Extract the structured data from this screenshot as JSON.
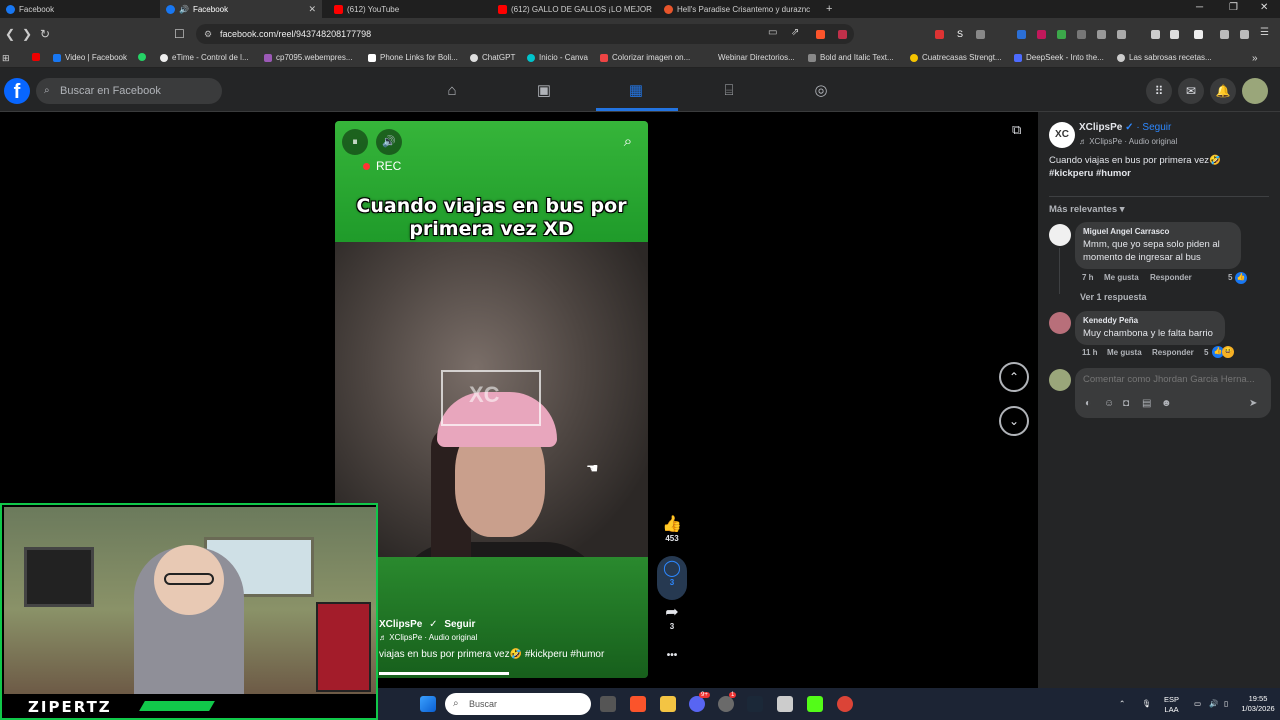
{
  "browser": {
    "tabs": [
      {
        "title": "Facebook",
        "active": false,
        "color": "#1877f2"
      },
      {
        "title": "Facebook",
        "active": true,
        "color": "#1877f2",
        "audio": true
      },
      {
        "title": "(612) YouTube",
        "active": false,
        "color": "#ff0000"
      },
      {
        "title": "(612) GALLO DE GALLOS ¡LO MEJOR",
        "active": false,
        "color": "#ff0000"
      },
      {
        "title": "Hell's Paradise Crisantemo y duraznc",
        "active": false,
        "color": "#e8552b"
      }
    ],
    "new_tab": "+",
    "url": "facebook.com/reel/943748208177798",
    "bookmarks": [
      "Video | Facebook",
      "eTime - Control de l...",
      "cp7095.webempres...",
      "Phone Links for Boli...",
      "ChatGPT",
      "Inicio - Canva",
      "Colorizar imagen on...",
      "Webinar Directorios...",
      "Bold and Italic Text...",
      "Cuatrecasas Strengt...",
      "DeepSeek - Into the...",
      "Las sabrosas recetas..."
    ],
    "extension_icon_initial": "S"
  },
  "facebook": {
    "search_placeholder": "Buscar en Facebook",
    "nav": [
      "home-icon",
      "video-icon",
      "reels-icon",
      "marketplace-icon",
      "gaming-icon"
    ],
    "active_nav": "reels-icon",
    "accent": "#2374e1"
  },
  "reel": {
    "headline": "Cuando viajas en bus por primera vez XD",
    "rec_label": "REC",
    "watermark": "XC",
    "author": "XClipsPe",
    "follow": "Seguir",
    "audio": "XClipsPe · Audio original",
    "caption": "viajas en bus por primera vez🤣 #kickperu #humor",
    "likes": "453",
    "comments": "3",
    "shares": "3",
    "more": "•••"
  },
  "panel": {
    "author": "XClipsPe",
    "verified": "✓",
    "follow": "· Seguir",
    "audio": "♬ XClipsPe · Audio original",
    "caption": "Cuando viajas en bus por primera vez🤣",
    "hashtags": "#kickperu #humor",
    "sort": "Más relevantes",
    "comments": [
      {
        "author": "Miguel Angel Carrasco",
        "text": "Mmm, que yo sepa solo piden al momento de ingresar al bus",
        "time": "7 h",
        "like": "Me gusta",
        "reply": "Responder",
        "reactions": "5"
      },
      {
        "author": "Keneddy Peña",
        "text": "Muy chambona y le falta barrio",
        "time": "11 h",
        "like": "Me gusta",
        "reply": "Responder",
        "reactions": "5"
      }
    ],
    "view_replies": "Ver 1 respuesta",
    "compose_placeholder": "Comentar como Jhordan Garcia Herna..."
  },
  "stream": {
    "label": "ZIPERTZ",
    "accent": "#11c84a"
  },
  "taskbar": {
    "search_placeholder": "Buscar",
    "lang": "ESP",
    "region": "LAA",
    "time": "19:55",
    "date": "1/03/2026",
    "badges": [
      "9+",
      "1"
    ]
  }
}
